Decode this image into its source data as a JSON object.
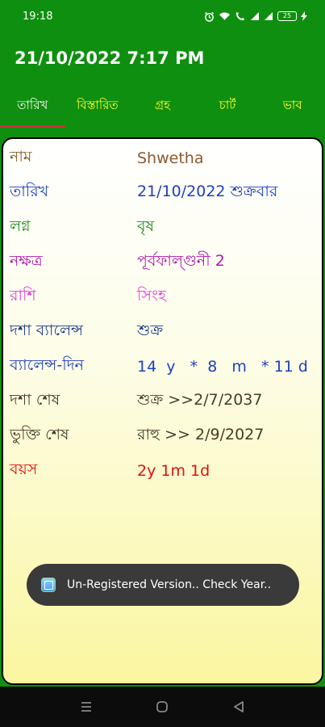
{
  "status_bar": {
    "time": "19:18",
    "battery": "25",
    "icons": [
      "alarm-icon",
      "wifi-icon",
      "call-icon",
      "signal-icon",
      "signal-icon",
      "battery-icon",
      "charging-icon"
    ]
  },
  "app_bar": {
    "title": "21/10/2022 7:17 PM"
  },
  "tabs": [
    {
      "label": "তারিখ",
      "active": true
    },
    {
      "label": "বিস্তারিত",
      "active": false
    },
    {
      "label": "গ্রহ",
      "active": false
    },
    {
      "label": "চার্ট",
      "active": false
    },
    {
      "label": "ভাব",
      "active": false
    }
  ],
  "details": [
    {
      "label": "নাম",
      "value": "Shwetha",
      "color": "#8b5a2b"
    },
    {
      "label": "তারিখ",
      "value": "21/10/2022 শুক্রবার",
      "color": "#1f3fbf"
    },
    {
      "label": "লগ্ন",
      "value": "বৃষ",
      "color": "#1e8e1e"
    },
    {
      "label": "নক্ষত্র",
      "value": "পূর্বফাল্গুনী 2",
      "color": "#b01ab0"
    },
    {
      "label": "রাশি",
      "value": "সিংহ",
      "color": "#e040e0"
    },
    {
      "label": "দশা ব্যালেন্স",
      "value": "শুক্র",
      "color": "#1e3a8a"
    },
    {
      "label": "ব্যালেন্স-দিন",
      "value": "14  y   *  8   m   * 11 d",
      "color": "#1f3fbf"
    },
    {
      "label": "দশা শেষ",
      "value": "শুক্র >>2/7/2037",
      "color": "#4a3a2a"
    },
    {
      "label": "ভুক্তি শেষ",
      "value": "রাহু >> 2/9/2027",
      "color": "#4a3a2a"
    },
    {
      "label": "বয়স",
      "value": "2y 1m 1d",
      "color": "#e01010"
    }
  ],
  "toast": {
    "message": "Un-Registered Version.. Check Year.."
  },
  "nav_bar": {
    "icons": [
      "recents-icon",
      "home-icon",
      "back-icon"
    ]
  }
}
